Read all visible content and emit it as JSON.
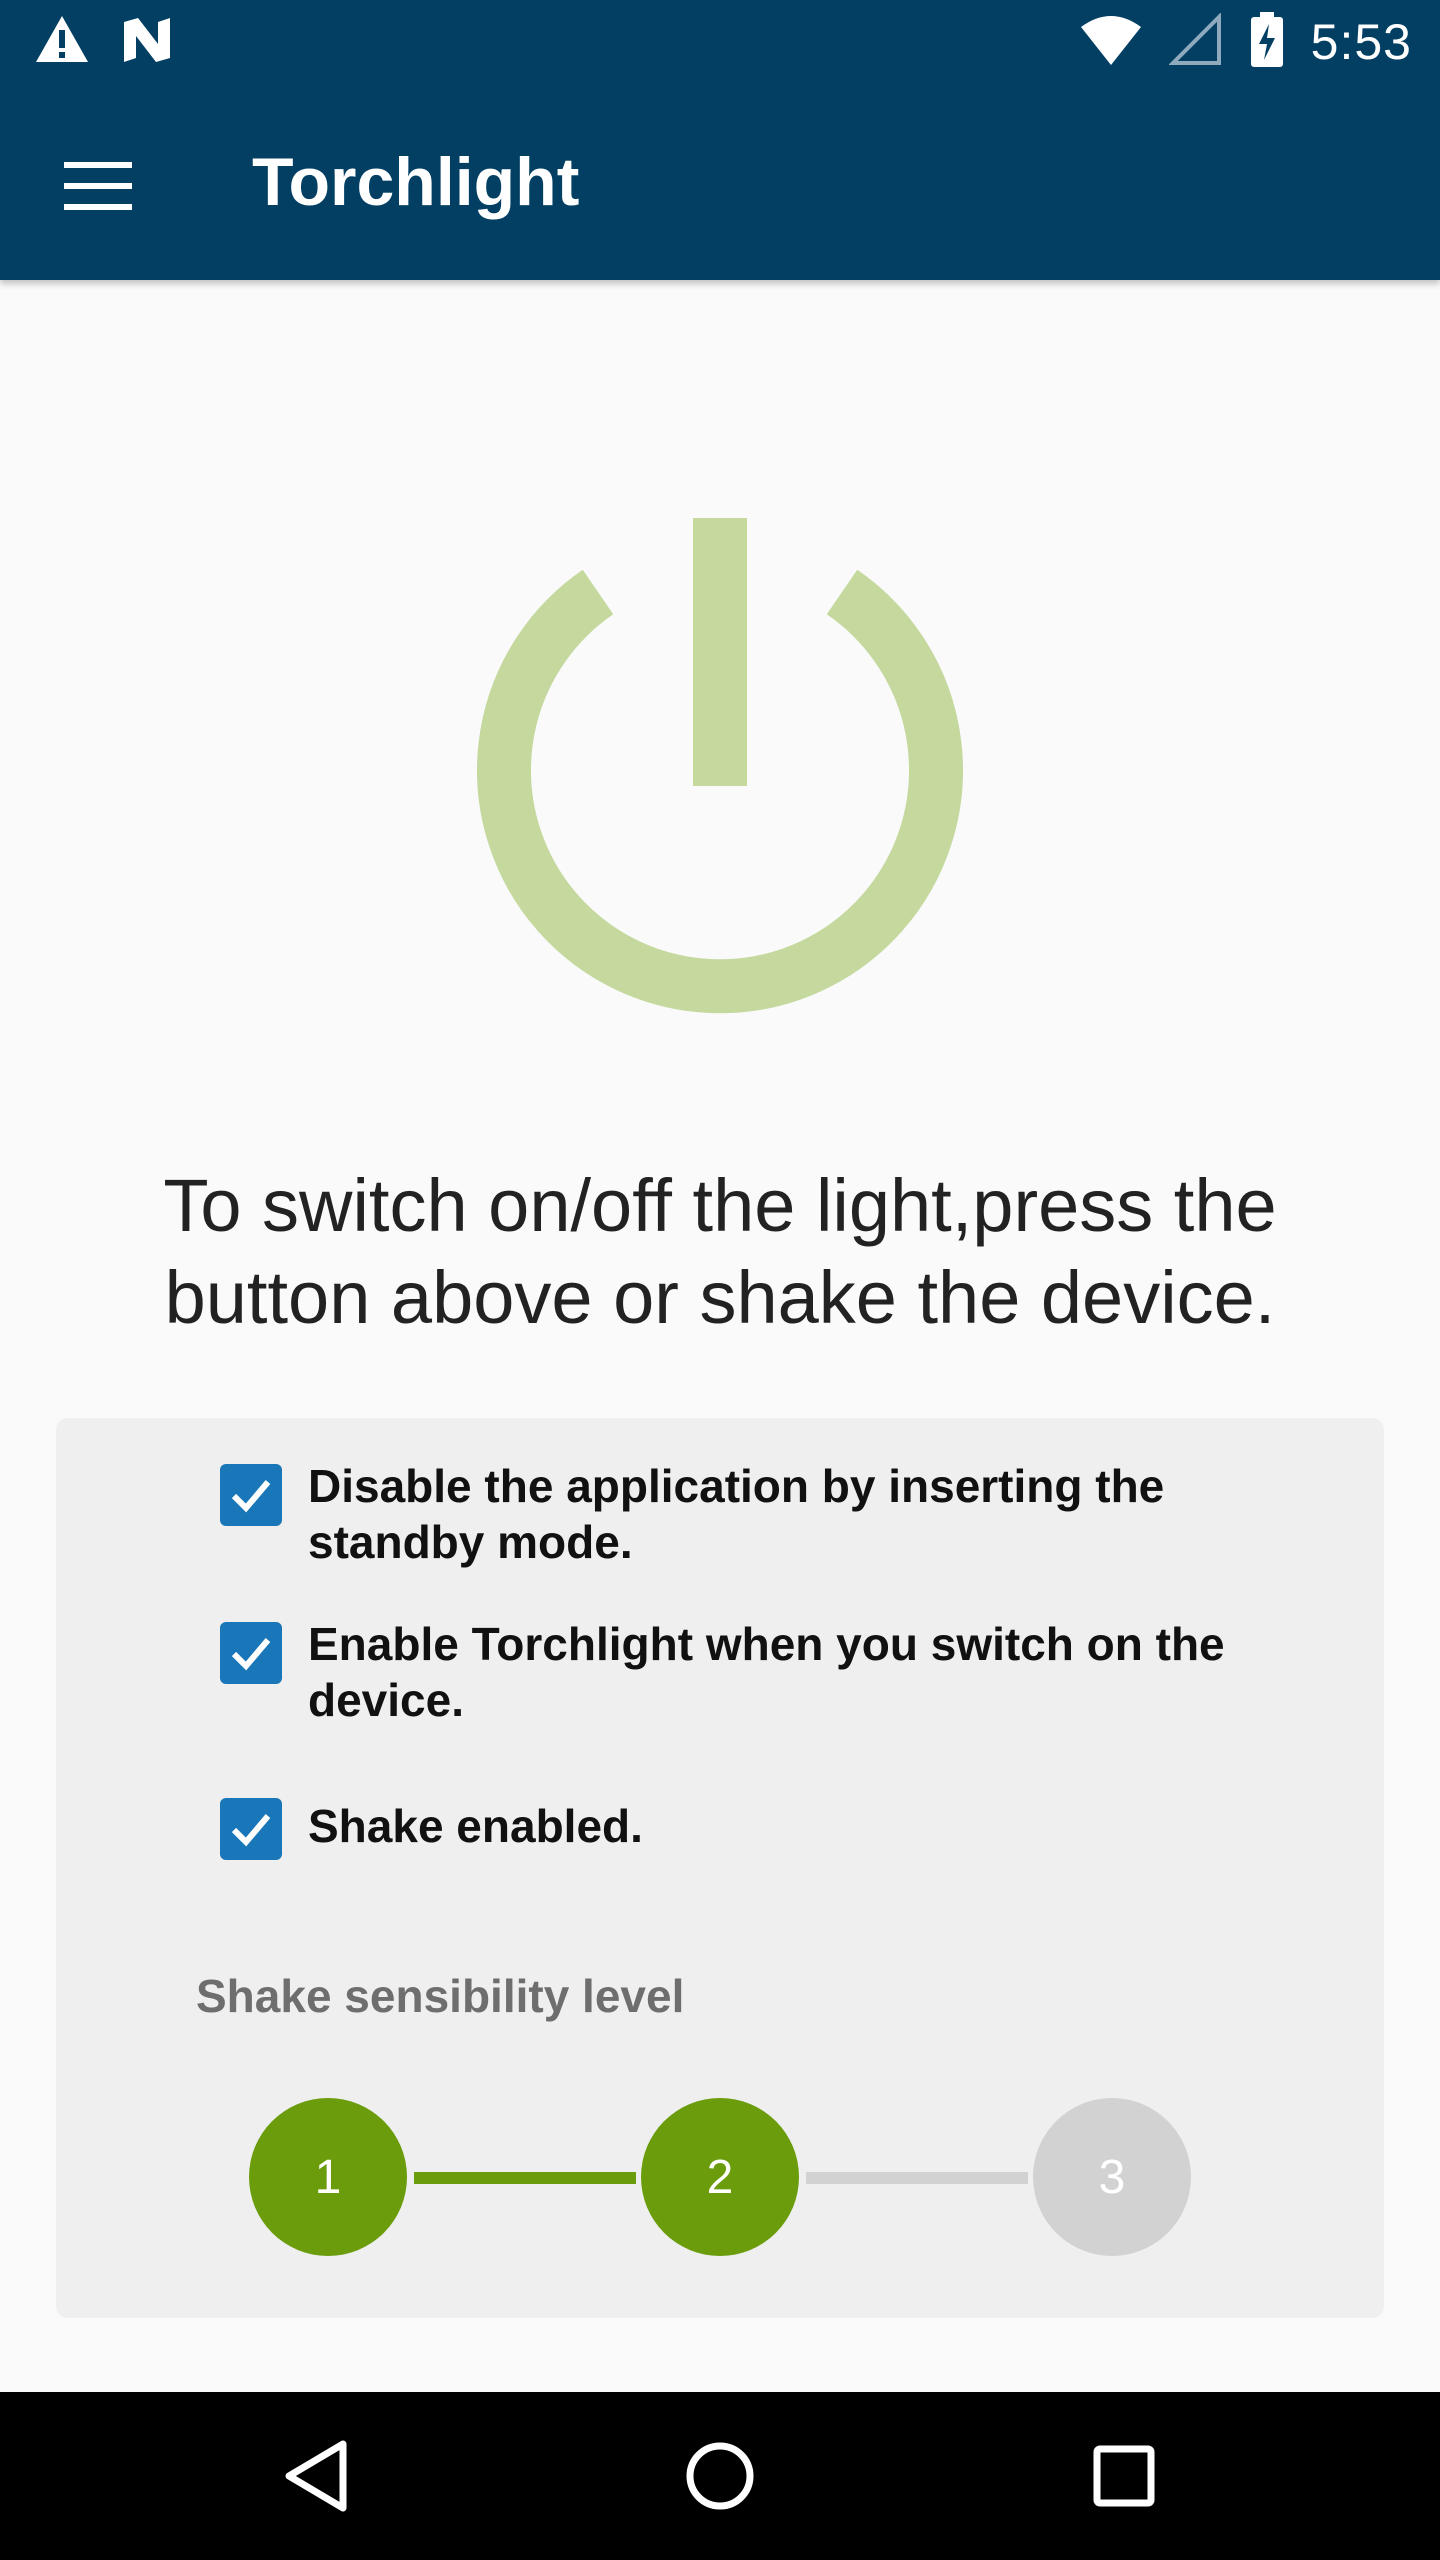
{
  "status_bar": {
    "time": "5:53",
    "icons": [
      "warning-icon",
      "notification-n-icon",
      "wifi-icon",
      "signal-icon",
      "battery-charging-icon"
    ]
  },
  "app_bar": {
    "title": "Torchlight",
    "menu_icon": "hamburger-menu-icon"
  },
  "power_button": {
    "icon": "power-icon",
    "color": "#c5d99f"
  },
  "instruction": "To switch on/off the light,press the button above or shake the device.",
  "settings": {
    "checkboxes": [
      {
        "label": "Disable the application by inserting the standby mode.",
        "checked": true
      },
      {
        "label": "Enable Torchlight when you switch on the device.",
        "checked": true
      },
      {
        "label": "Shake enabled.",
        "checked": true
      }
    ],
    "sensibility_label": "Shake sensibility level",
    "levels": [
      {
        "label": "1",
        "active": true
      },
      {
        "label": "2",
        "active": true
      },
      {
        "label": "3",
        "active": false
      }
    ],
    "selected_level": 2
  },
  "colors": {
    "primary": "#023f63",
    "checkbox": "#1976b8",
    "active_step": "#6a9c0b",
    "inactive_step": "#d2d2d2",
    "power_icon": "#c5d99f"
  },
  "nav_bar": {
    "buttons": [
      "back-icon",
      "home-icon",
      "recents-icon"
    ]
  }
}
